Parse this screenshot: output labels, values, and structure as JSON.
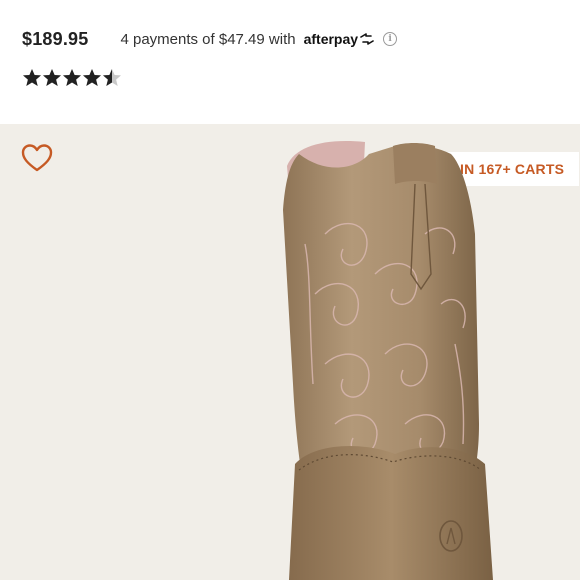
{
  "listing": {
    "price": "$189.95",
    "installments_text": "4 payments of $47.49 with",
    "afterpay_label": "afterpay",
    "rating": 4.5,
    "rating_max": 5
  },
  "product": {
    "cart_badge": "IN 167+ CARTS"
  },
  "colors": {
    "accent": "#c65a24",
    "background": "#f1eee8"
  },
  "icons": {
    "heart": "heart-icon",
    "flame": "flame-icon",
    "info": "info-icon",
    "star": "star-icon"
  }
}
